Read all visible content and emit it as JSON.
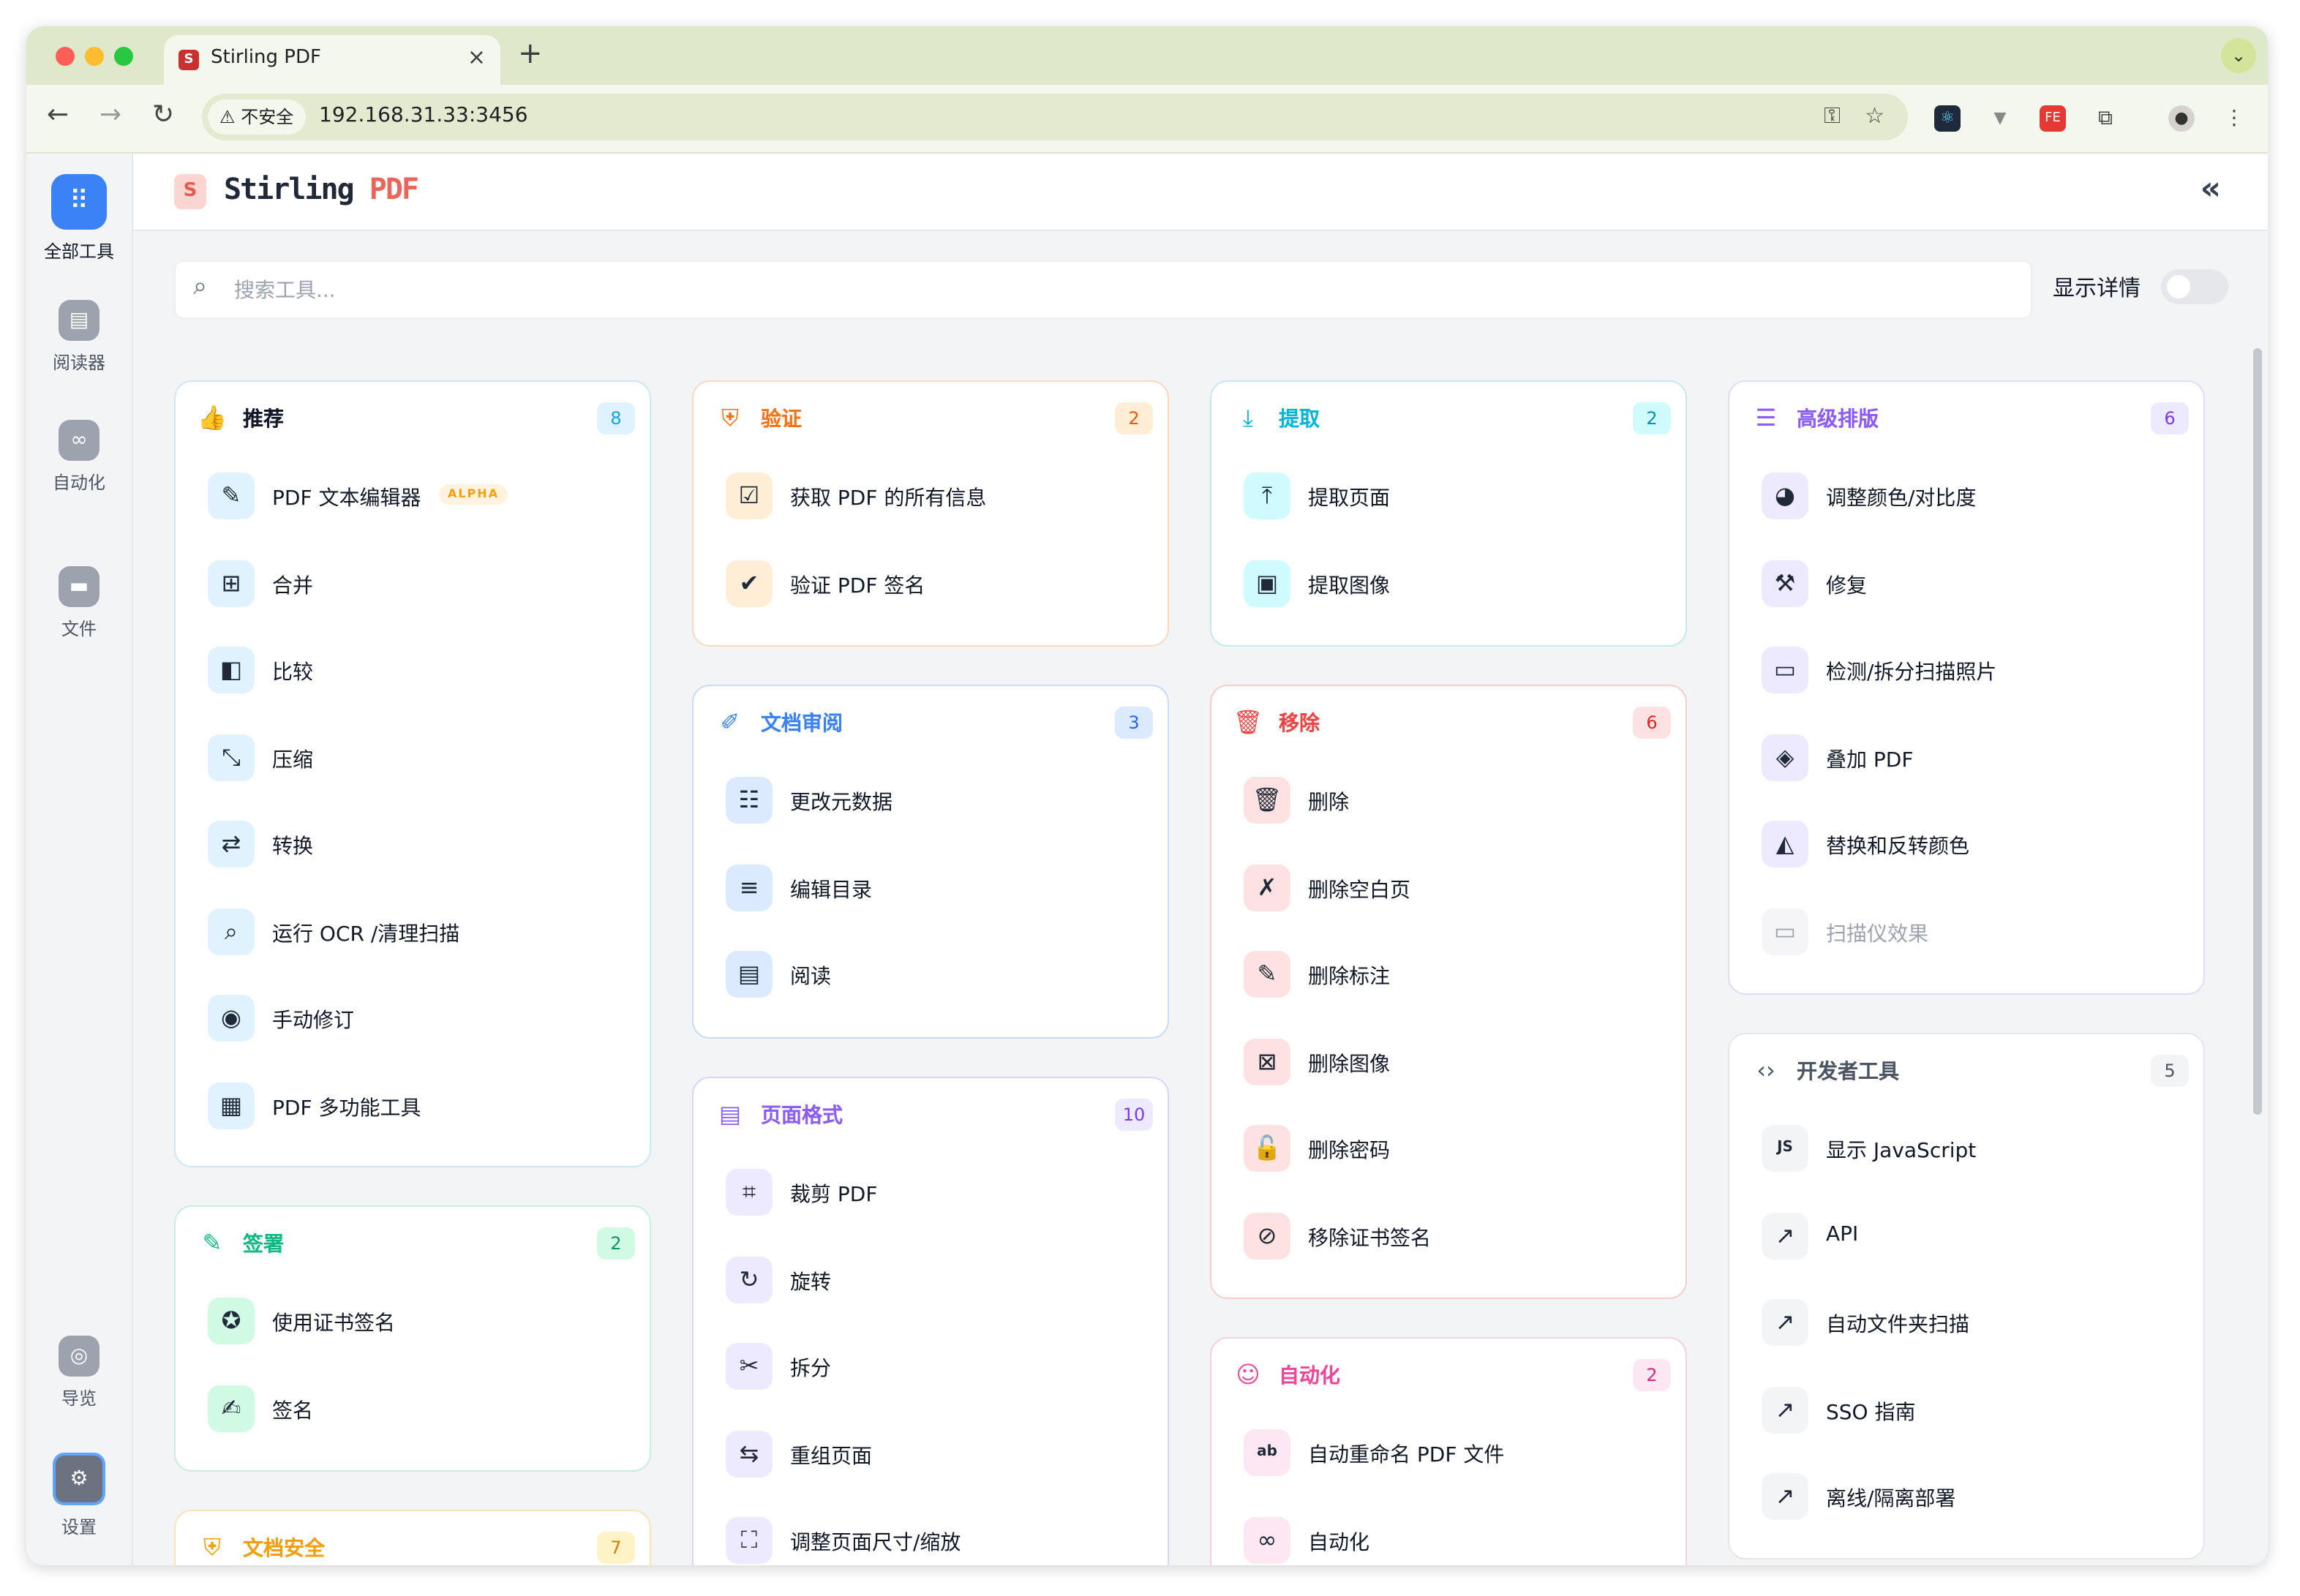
{
  "browser": {
    "tab_title": "Stirling PDF",
    "tab_favicon": "S",
    "security_label": "不安全",
    "url": "192.168.31.33:3456",
    "close_glyph": "×",
    "new_tab_glyph": "+"
  },
  "app": {
    "brand_left": "Stirling",
    "brand_right": "PDF",
    "logo_letter": "S",
    "search_placeholder": "搜索工具...",
    "show_details_label": "显示详情",
    "show_details_on": false
  },
  "rail": [
    {
      "label": "全部工具",
      "icon": "grid-icon",
      "active": true
    },
    {
      "label": "阅读器",
      "icon": "book-icon",
      "active": false
    },
    {
      "label": "自动化",
      "icon": "automation-icon",
      "active": false
    },
    {
      "label": "文件",
      "icon": "folder-icon",
      "active": false
    },
    {
      "label": "导览",
      "icon": "compass-icon",
      "active": false
    },
    {
      "label": "设置",
      "icon": "gear-icon",
      "active": false
    }
  ],
  "colors": {
    "accent": "#3b82f6",
    "brand": "#e8665b"
  },
  "categories": [
    {
      "id": "recommended",
      "title": "推荐",
      "count": "8",
      "color": "#111827",
      "badge_bg": "#e0f2fe",
      "badge_fg": "#0ea5e9",
      "border": "#cde8f5",
      "icon": "thumbs-up-icon",
      "items": [
        {
          "label": "PDF 文本编辑器",
          "icon": "edit-icon",
          "tag": "ALPHA"
        },
        {
          "label": "合并",
          "icon": "merge-icon"
        },
        {
          "label": "比较",
          "icon": "compare-icon"
        },
        {
          "label": "压缩",
          "icon": "compress-icon"
        },
        {
          "label": "转换",
          "icon": "convert-icon"
        },
        {
          "label": "运行 OCR /清理扫描",
          "icon": "ocr-icon"
        },
        {
          "label": "手动修订",
          "icon": "redact-icon"
        },
        {
          "label": "PDF 多功能工具",
          "icon": "multitool-icon"
        }
      ]
    },
    {
      "id": "signing",
      "title": "签署",
      "count": "2",
      "color": "#10b981",
      "badge_bg": "#d1fae5",
      "badge_fg": "#059669",
      "border": "#c9eedf",
      "icon": "signature-icon",
      "items": [
        {
          "label": "使用证书签名",
          "icon": "certificate-icon"
        },
        {
          "label": "签名",
          "icon": "sign-icon"
        }
      ]
    },
    {
      "id": "security",
      "title": "文档安全",
      "count": "7",
      "color": "#f59e0b",
      "badge_bg": "#fef3c7",
      "badge_fg": "#d97706",
      "border": "#f8e3b7",
      "icon": "shield-icon",
      "items": []
    },
    {
      "id": "verify",
      "title": "验证",
      "count": "2",
      "color": "#f97316",
      "badge_bg": "#ffedd5",
      "badge_fg": "#ea580c",
      "border": "#f9d8c1",
      "icon": "shield-check-icon",
      "items": [
        {
          "label": "获取 PDF 的所有信息",
          "icon": "info-icon"
        },
        {
          "label": "验证 PDF 签名",
          "icon": "verified-icon"
        }
      ]
    },
    {
      "id": "review",
      "title": "文档审阅",
      "count": "3",
      "color": "#3b82f6",
      "badge_bg": "#dbeafe",
      "badge_fg": "#2563eb",
      "border": "#c9dbf6",
      "icon": "review-icon",
      "items": [
        {
          "label": "更改元数据",
          "icon": "metadata-icon"
        },
        {
          "label": "编辑目录",
          "icon": "toc-icon"
        },
        {
          "label": "阅读",
          "icon": "read-icon"
        }
      ]
    },
    {
      "id": "page-format",
      "title": "页面格式",
      "count": "10",
      "color": "#8b5cf6",
      "badge_bg": "#ede9fe",
      "badge_fg": "#7c3aed",
      "border": "#ddd4f8",
      "icon": "page-format-icon",
      "items": [
        {
          "label": "裁剪 PDF",
          "icon": "crop-icon"
        },
        {
          "label": "旋转",
          "icon": "rotate-icon"
        },
        {
          "label": "拆分",
          "icon": "scissors-icon"
        },
        {
          "label": "重组页面",
          "icon": "reorganize-icon"
        },
        {
          "label": "调整页面尺寸/缩放",
          "icon": "resize-icon"
        }
      ]
    },
    {
      "id": "extract",
      "title": "提取",
      "count": "2",
      "color": "#06b6d4",
      "badge_bg": "#cffafe",
      "badge_fg": "#0891b2",
      "border": "#c4eaf1",
      "icon": "download-icon",
      "items": [
        {
          "label": "提取页面",
          "icon": "upload-icon"
        },
        {
          "label": "提取图像",
          "icon": "images-icon"
        }
      ]
    },
    {
      "id": "remove",
      "title": "移除",
      "count": "6",
      "color": "#ef4444",
      "badge_bg": "#fee2e2",
      "badge_fg": "#dc2626",
      "border": "#f8cdcd",
      "icon": "trash-list-icon",
      "items": [
        {
          "label": "删除",
          "icon": "trash-icon"
        },
        {
          "label": "删除空白页",
          "icon": "blank-page-icon"
        },
        {
          "label": "删除标注",
          "icon": "annotation-icon"
        },
        {
          "label": "删除图像",
          "icon": "remove-image-icon"
        },
        {
          "label": "删除密码",
          "icon": "unlock-icon"
        },
        {
          "label": "移除证书签名",
          "icon": "remove-cert-icon"
        }
      ]
    },
    {
      "id": "automation",
      "title": "自动化",
      "count": "2",
      "color": "#ec4899",
      "badge_bg": "#fce7f3",
      "badge_fg": "#db2777",
      "border": "#f5d0e3",
      "icon": "robot-icon",
      "items": [
        {
          "label": "自动重命名 PDF 文件",
          "icon": "rename-icon"
        },
        {
          "label": "自动化",
          "icon": "automation-icon"
        }
      ]
    },
    {
      "id": "advanced",
      "title": "高级排版",
      "count": "6",
      "color": "#8b5cf6",
      "badge_bg": "#ede9fe",
      "badge_fg": "#7c3aed",
      "border": "#e3dbf7",
      "icon": "sliders-icon",
      "items": [
        {
          "label": "调整颜色/对比度",
          "icon": "palette-icon"
        },
        {
          "label": "修复",
          "icon": "wrench-icon"
        },
        {
          "label": "检测/拆分扫描照片",
          "icon": "scanner-icon"
        },
        {
          "label": "叠加 PDF",
          "icon": "layers-icon"
        },
        {
          "label": "替换和反转颜色",
          "icon": "paint-bucket-icon"
        },
        {
          "label": "扫描仪效果",
          "icon": "scanner-effect-icon",
          "disabled": true
        }
      ]
    },
    {
      "id": "developer",
      "title": "开发者工具",
      "count": "5",
      "color": "#4b5563",
      "badge_bg": "#f3f4f6",
      "badge_fg": "#4b5563",
      "border": "#e5e7eb",
      "icon": "code-icon",
      "items": [
        {
          "label": "显示 JavaScript",
          "icon": "js-icon"
        },
        {
          "label": "API",
          "icon": "external-link-icon"
        },
        {
          "label": "自动文件夹扫描",
          "icon": "external-link-icon"
        },
        {
          "label": "SSO 指南",
          "icon": "external-link-icon"
        },
        {
          "label": "离线/隔离部署",
          "icon": "external-link-icon"
        }
      ]
    }
  ]
}
